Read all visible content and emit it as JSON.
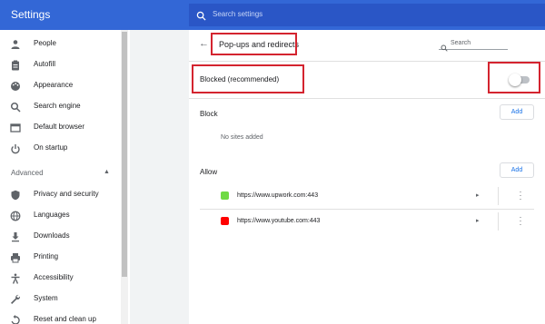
{
  "app": {
    "title": "Settings"
  },
  "search": {
    "placeholder": "Search settings"
  },
  "sidebar": {
    "items": [
      {
        "label": "People",
        "icon": "person-icon"
      },
      {
        "label": "Autofill",
        "icon": "clipboard-icon"
      },
      {
        "label": "Appearance",
        "icon": "palette-icon"
      },
      {
        "label": "Search engine",
        "icon": "search-icon"
      },
      {
        "label": "Default browser",
        "icon": "browser-icon"
      },
      {
        "label": "On startup",
        "icon": "power-icon"
      }
    ],
    "advanced_label": "Advanced",
    "advanced_items": [
      {
        "label": "Privacy and security",
        "icon": "shield-icon"
      },
      {
        "label": "Languages",
        "icon": "globe-icon"
      },
      {
        "label": "Downloads",
        "icon": "download-icon"
      },
      {
        "label": "Printing",
        "icon": "printer-icon"
      },
      {
        "label": "Accessibility",
        "icon": "accessibility-icon"
      },
      {
        "label": "System",
        "icon": "wrench-icon"
      },
      {
        "label": "Reset and clean up",
        "icon": "reset-icon"
      }
    ]
  },
  "page": {
    "title": "Pop-ups and redirects",
    "search_placeholder": "Search",
    "blocked_label": "Blocked (recommended)",
    "blocked_toggle_on": false,
    "block_section": {
      "label": "Block",
      "add_label": "Add",
      "empty_text": "No sites added"
    },
    "allow_section": {
      "label": "Allow",
      "add_label": "Add",
      "sites": [
        {
          "url": "https://www.upwork.com:443",
          "favicon": "upwork-icon",
          "color": "#6fda44"
        },
        {
          "url": "https://www.youtube.com:443",
          "favicon": "youtube-icon",
          "color": "#ff0000"
        }
      ]
    }
  },
  "colors": {
    "header": "#3367d6",
    "accent": "#1a73e8",
    "highlight": "#d4242f"
  }
}
